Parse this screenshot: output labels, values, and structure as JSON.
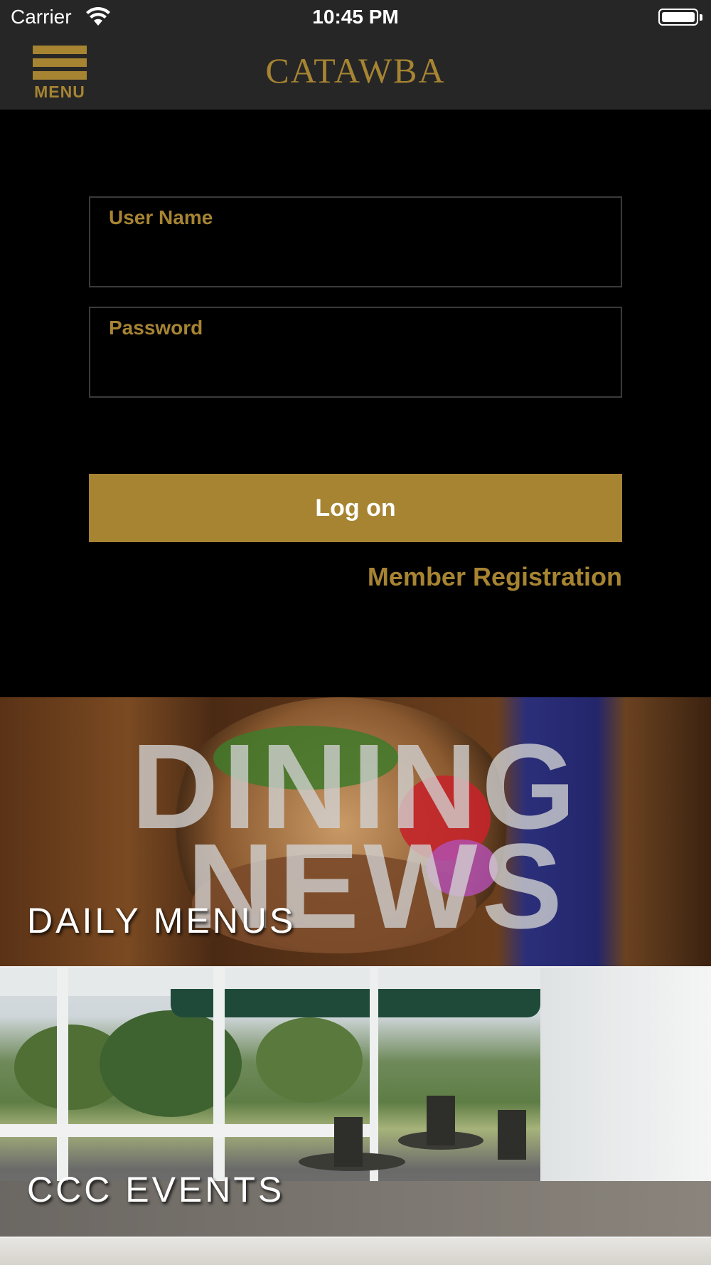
{
  "status_bar": {
    "carrier": "Carrier",
    "time": "10:45 PM",
    "icons": [
      "wifi-icon",
      "battery-icon"
    ]
  },
  "nav": {
    "menu_label": "MENU",
    "title": "CATAWBA",
    "menu_icon": "hamburger-icon"
  },
  "login": {
    "username_label": "User Name",
    "username_value": "",
    "password_label": "Password",
    "password_value": "",
    "logon_label": "Log on",
    "register_label": "Member Registration"
  },
  "tiles": [
    {
      "caption": "DAILY MENUS",
      "image_text_1": "DINING",
      "image_text_2": "NEWS"
    },
    {
      "caption": "CCC EVENTS"
    }
  ],
  "colors": {
    "accent": "#a68432",
    "bar_background": "#262626",
    "page_background": "#000000"
  }
}
